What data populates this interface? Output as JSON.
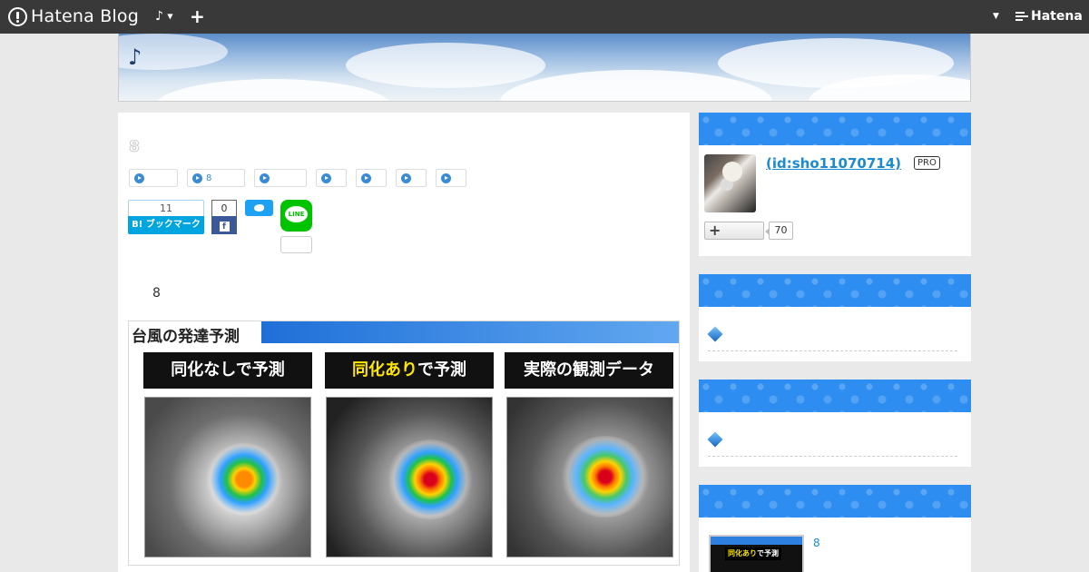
{
  "topbar": {
    "logo_text": "Hatena Blog",
    "music_label": "♪",
    "add_label": "+",
    "account_label": "Hatena",
    "icons": [
      "hatena-logo-icon",
      "caret-down-icon",
      "plus-icon",
      "hatena-brand-icon"
    ]
  },
  "blog": {
    "title": "♪"
  },
  "entry": {
    "title": "8",
    "keywords": [
      "",
      "8",
      "",
      "",
      "",
      "",
      ""
    ],
    "share": {
      "hatena_bookmark_count": "11",
      "hatena_bookmark_label": "B! ブックマーク",
      "facebook_count": "0",
      "facebook_label": "f",
      "line_label": "LINE",
      "line_count": ""
    },
    "lead_text": "8",
    "image": {
      "header_title": "台風の発達予測",
      "panels": [
        {
          "label_part1": "同化なしで予測",
          "label_highlight": "",
          "label_part2": ""
        },
        {
          "label_part1": "",
          "label_highlight": "同化あり",
          "label_part2": "で予測"
        },
        {
          "label_part1": "実際の観測データ",
          "label_highlight": "",
          "label_part2": ""
        }
      ]
    }
  },
  "sidebar": {
    "profile": {
      "user_id": " (id:sho11070714)",
      "badge": "PRO",
      "follow_label": "+",
      "follow_count": "70"
    },
    "module2": {
      "item_text": ""
    },
    "module3": {
      "item_text": ""
    },
    "recent": {
      "link_text": "8",
      "thumb_highlight": "同化あり",
      "thumb_text": "で予測"
    }
  },
  "colors": {
    "topbar_bg": "#393939",
    "accent_blue": "#2d8df0",
    "link_blue": "#1a8bd1",
    "hatena_bookmark": "#00a4de",
    "facebook": "#3b5998",
    "twitter": "#1da1f2",
    "line": "#00c300"
  }
}
